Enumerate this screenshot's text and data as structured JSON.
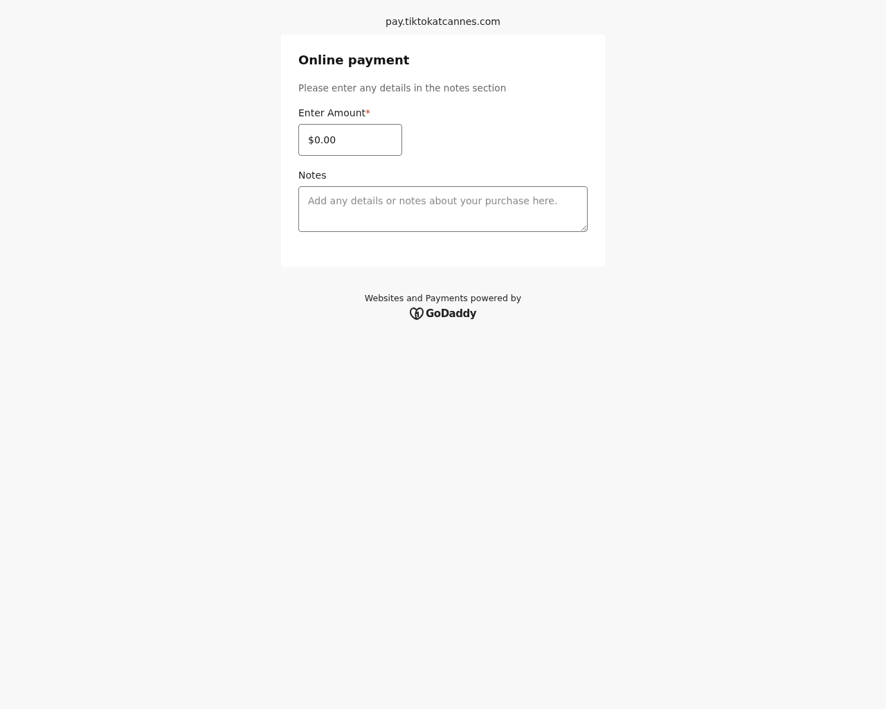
{
  "site": {
    "domain": "pay.tiktokatcannes.com"
  },
  "form": {
    "title": "Online payment",
    "subtitle": "Please enter any details in the notes section",
    "amount": {
      "label": "Enter Amount",
      "required_mark": "*",
      "value": "$0.00"
    },
    "notes": {
      "label": "Notes",
      "placeholder": "Add any details or notes about your purchase here."
    }
  },
  "footer": {
    "text": "Websites and Payments powered by",
    "brand": "GoDaddy"
  }
}
